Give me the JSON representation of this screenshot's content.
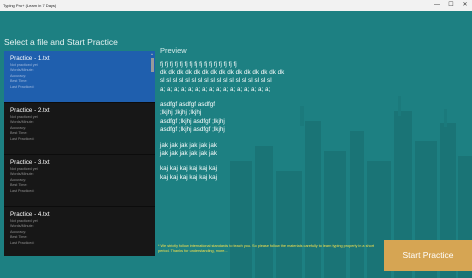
{
  "window": {
    "title": "Typing Pro+ (Learn in 7 Days)",
    "controls": [
      "—",
      "☐",
      "✕"
    ]
  },
  "left_panel": {
    "title": "Select a file and Start Practice"
  },
  "files": [
    {
      "name": "Practice - 1.txt",
      "status": "Not practiced yet",
      "meta": [
        "Words/Minute:",
        "Accuracy:",
        "Best Time:",
        "Last Practiced:"
      ]
    },
    {
      "name": "Practice - 2.txt",
      "status": "Not practiced yet",
      "meta": [
        "Words/Minute:",
        "Accuracy:",
        "Best Time:",
        "Last Practiced:"
      ]
    },
    {
      "name": "Practice - 3.txt",
      "status": "Not practiced yet",
      "meta": [
        "Words/Minute:",
        "Accuracy:",
        "Best Time:",
        "Last Practiced:"
      ]
    },
    {
      "name": "Practice - 4.txt",
      "status": "Not practiced yet",
      "meta": [
        "Words/Minute:",
        "Accuracy:",
        "Best Time:",
        "Last Practiced:"
      ]
    }
  ],
  "selected_file_index": 0,
  "preview": {
    "title": "Preview",
    "lines": [
      "fj fj fj fj fj fj fj fj fj fj fj fj fj fj fj fj",
      "dk dk dk dk dk dk dk dk dk dk dk dk dk dk dk",
      "sl sl sl sl sl sl sl sl sl sl sl sl sl sl sl sl sl sl",
      "a; a; a; a; a; a; a; a; a; a; a; a; a; a; a; a;",
      "",
      "asdfgf asdfgf asdfgf",
      ";lkjhj ;lkjhj ;lkjhj",
      "asdfgf ;lkjhj asdfgf ;lkjhj",
      "asdfgf ;lkjhj asdfgf ;lkjhj",
      "",
      "jak jak jak jak jak jak",
      "jak jak jak jak jak jak",
      "",
      "kaj kaj kaj kaj kaj kaj",
      "kaj kaj kaj kaj kaj kaj"
    ]
  },
  "footer": {
    "note": "* We strictly follow international standards to teach you. So please follow the materials carefully to learn typing properly in a short period. Thanks for understanding, more..."
  },
  "start_button": {
    "label": "Start Practice"
  },
  "colors": {
    "background": "#1d8082",
    "selected_item": "#1f5fae",
    "list_background": "#171717",
    "start_button": "#d6a553",
    "note_text": "#f4e04d"
  }
}
